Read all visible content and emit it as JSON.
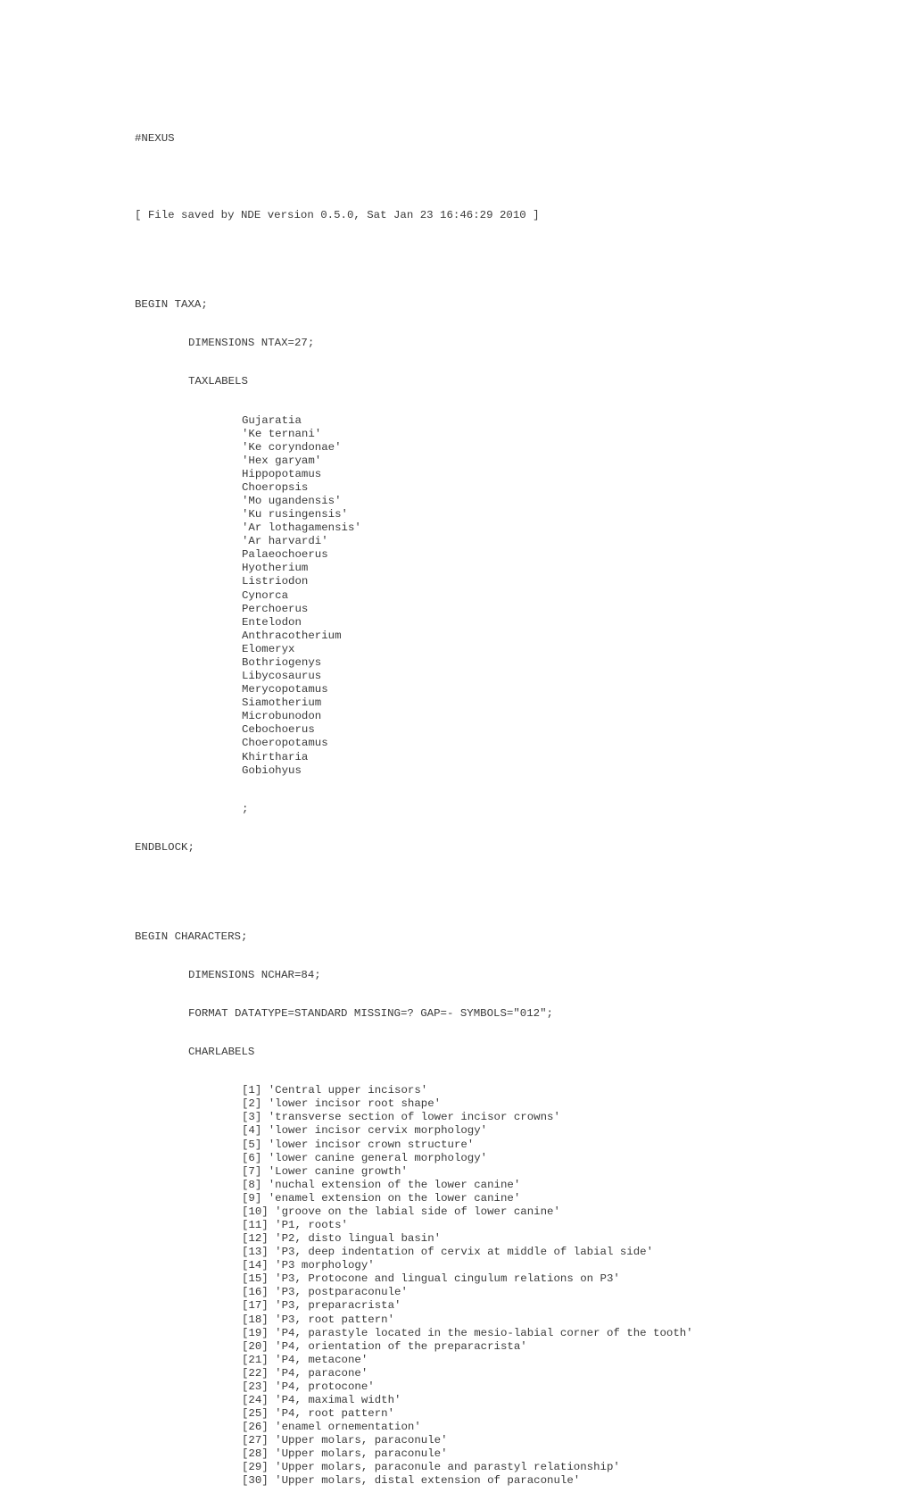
{
  "header": {
    "magic": "#NEXUS",
    "comment": "[ File saved by NDE version 0.5.0, Sat Jan 23 16:46:29 2010 ]"
  },
  "taxa_block": {
    "begin": "BEGIN TAXA;",
    "dimensions": "DIMENSIONS NTAX=27;",
    "taxlabels_keyword": "TAXLABELS",
    "taxa": [
      "Gujaratia",
      "'Ke ternani'",
      "'Ke coryndonae'",
      "'Hex garyam'",
      "Hippopotamus",
      "Choeropsis",
      "'Mo ugandensis'",
      "'Ku rusingensis'",
      "'Ar lothagamensis'",
      "'Ar harvardi'",
      "Palaeochoerus",
      "Hyotherium",
      "Listriodon",
      "Cynorca",
      "Perchoerus",
      "Entelodon",
      "Anthracotherium",
      "Elomeryx",
      "Bothriogenys",
      "Libycosaurus",
      "Merycopotamus",
      "Siamotherium",
      "Microbunodon",
      "Cebochoerus",
      "Choeropotamus",
      "Khirtharia",
      "Gobiohyus"
    ],
    "terminator": ";",
    "end": "ENDBLOCK;"
  },
  "characters_block": {
    "begin": "BEGIN CHARACTERS;",
    "dimensions": "DIMENSIONS NCHAR=84;",
    "format": "FORMAT DATATYPE=STANDARD MISSING=? GAP=- SYMBOLS=\"012\";",
    "charlabels_keyword": "CHARLABELS",
    "charlabels": [
      "[1] 'Central upper incisors'",
      "[2] 'lower incisor root shape'",
      "[3] 'transverse section of lower incisor crowns'",
      "[4] 'lower incisor cervix morphology'",
      "[5] 'lower incisor crown structure'",
      "[6] 'lower canine general morphology'",
      "[7] 'Lower canine growth'",
      "[8] 'nuchal extension of the lower canine'",
      "[9] 'enamel extension on the lower canine'",
      "[10] 'groove on the labial side of lower canine'",
      "[11] 'P1, roots'",
      "[12] 'P2, disto lingual basin'",
      "[13] 'P3, deep indentation of cervix at middle of labial side'",
      "[14] 'P3 morphology'",
      "[15] 'P3, Protocone and lingual cingulum relations on P3'",
      "[16] 'P3, postparaconule'",
      "[17] 'P3, preparacrista'",
      "[18] 'P3, root pattern'",
      "[19] 'P4, parastyle located in the mesio-labial corner of the tooth'",
      "[20] 'P4, orientation of the preparacrista'",
      "[21] 'P4, metacone'",
      "[22] 'P4, paracone'",
      "[23] 'P4, protocone'",
      "[24] 'P4, maximal width'",
      "[25] 'P4, root pattern'",
      "[26] 'enamel ornementation'",
      "[27] 'Upper molars, paraconule'",
      "[28] 'Upper molars, paraconule'",
      "[29] 'Upper molars, paraconule and parastyl relationship'",
      "[30] 'Upper molars, distal extension of paraconule'"
    ]
  }
}
